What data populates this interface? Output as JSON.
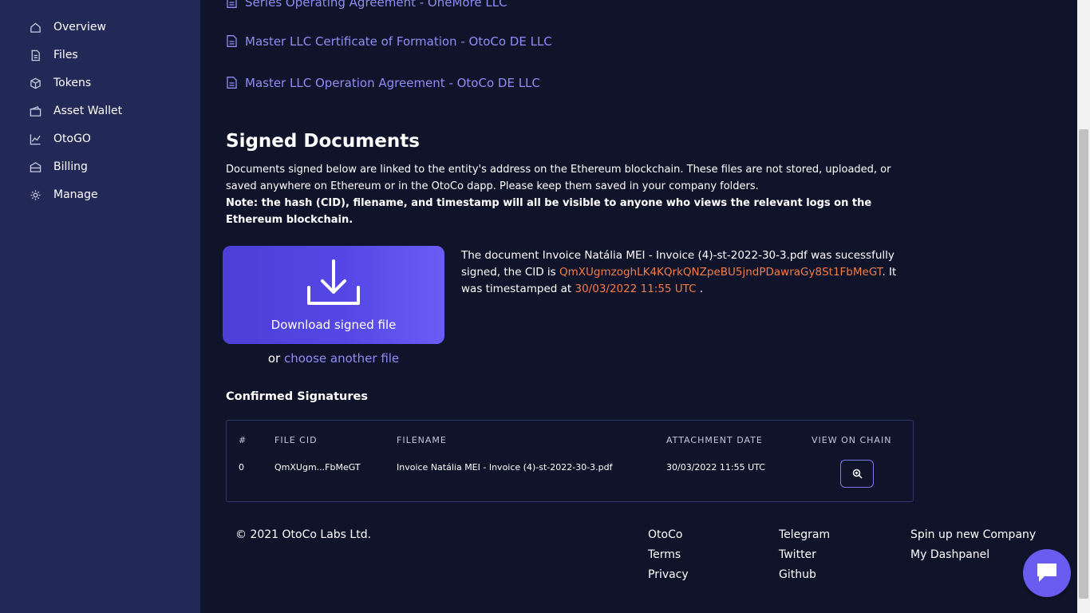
{
  "sidebar": {
    "items": [
      {
        "label": "Overview",
        "icon": "home-icon"
      },
      {
        "label": "Files",
        "icon": "file-icon"
      },
      {
        "label": "Tokens",
        "icon": "cube-icon"
      },
      {
        "label": "Asset Wallet",
        "icon": "wallet-icon"
      },
      {
        "label": "OtoGO",
        "icon": "chart-line-icon"
      },
      {
        "label": "Billing",
        "icon": "billing-icon"
      },
      {
        "label": "Manage",
        "icon": "gear-icon"
      }
    ]
  },
  "documents": [
    "Series Operating Agreement - OneMore LLC",
    "Master LLC Certificate of Formation - OtoCo DE LLC",
    "Master LLC Operation Agreement - OtoCo DE LLC"
  ],
  "signed": {
    "title": "Signed Documents",
    "desc": "Documents signed below are linked to the entity's address on the Ethereum blockchain. These files are not stored, uploaded, or saved anywhere on Ethereum or in the OtoCo dapp. Please keep them saved in your company folders.",
    "note": "Note: the hash (CID), filename, and timestamp will all be visible to anyone who views the relevant logs on the Ethereum blockchain.",
    "download_label": "Download signed file",
    "or_text": "or",
    "choose_label": "choose another file",
    "msg_part1": "The document Invoice Natália MEI - Invoice (4)-st-2022-30-3.pdf was sucessfully signed, the CID is",
    "cid": "QmXUgmzoghLK4KQrkQNZpeBU5jndPDawraGy8St1FbMeGT",
    "msg_part2": ". It was timestamped at",
    "timestamp": "30/03/2022 11:55 UTC",
    "msg_part3": "."
  },
  "confirmed": {
    "title": "Confirmed Signatures",
    "headers": {
      "num": "#",
      "cid": "FILE CID",
      "filename": "FILENAME",
      "date": "ATTACHMENT DATE",
      "chain": "VIEW ON CHAIN"
    },
    "rows": [
      {
        "num": "0",
        "cid": "QmXUgm...FbMeGT",
        "filename": "Invoice Natália MEI - Invoice (4)-st-2022-30-3.pdf",
        "date": "30/03/2022 11:55 UTC"
      }
    ]
  },
  "footer": {
    "copyright": "© 2021 OtoCo Labs Ltd.",
    "col1": [
      "OtoCo",
      "Terms",
      "Privacy"
    ],
    "col2": [
      "Telegram",
      "Twitter",
      "Github"
    ],
    "col3": [
      "Spin up new Company",
      "My Dashpanel"
    ]
  },
  "colors": {
    "background": "#10142a",
    "sidebar": "#232957",
    "link": "#8f8cf5",
    "highlight": "#f47c48",
    "accent": "#5547e6"
  }
}
